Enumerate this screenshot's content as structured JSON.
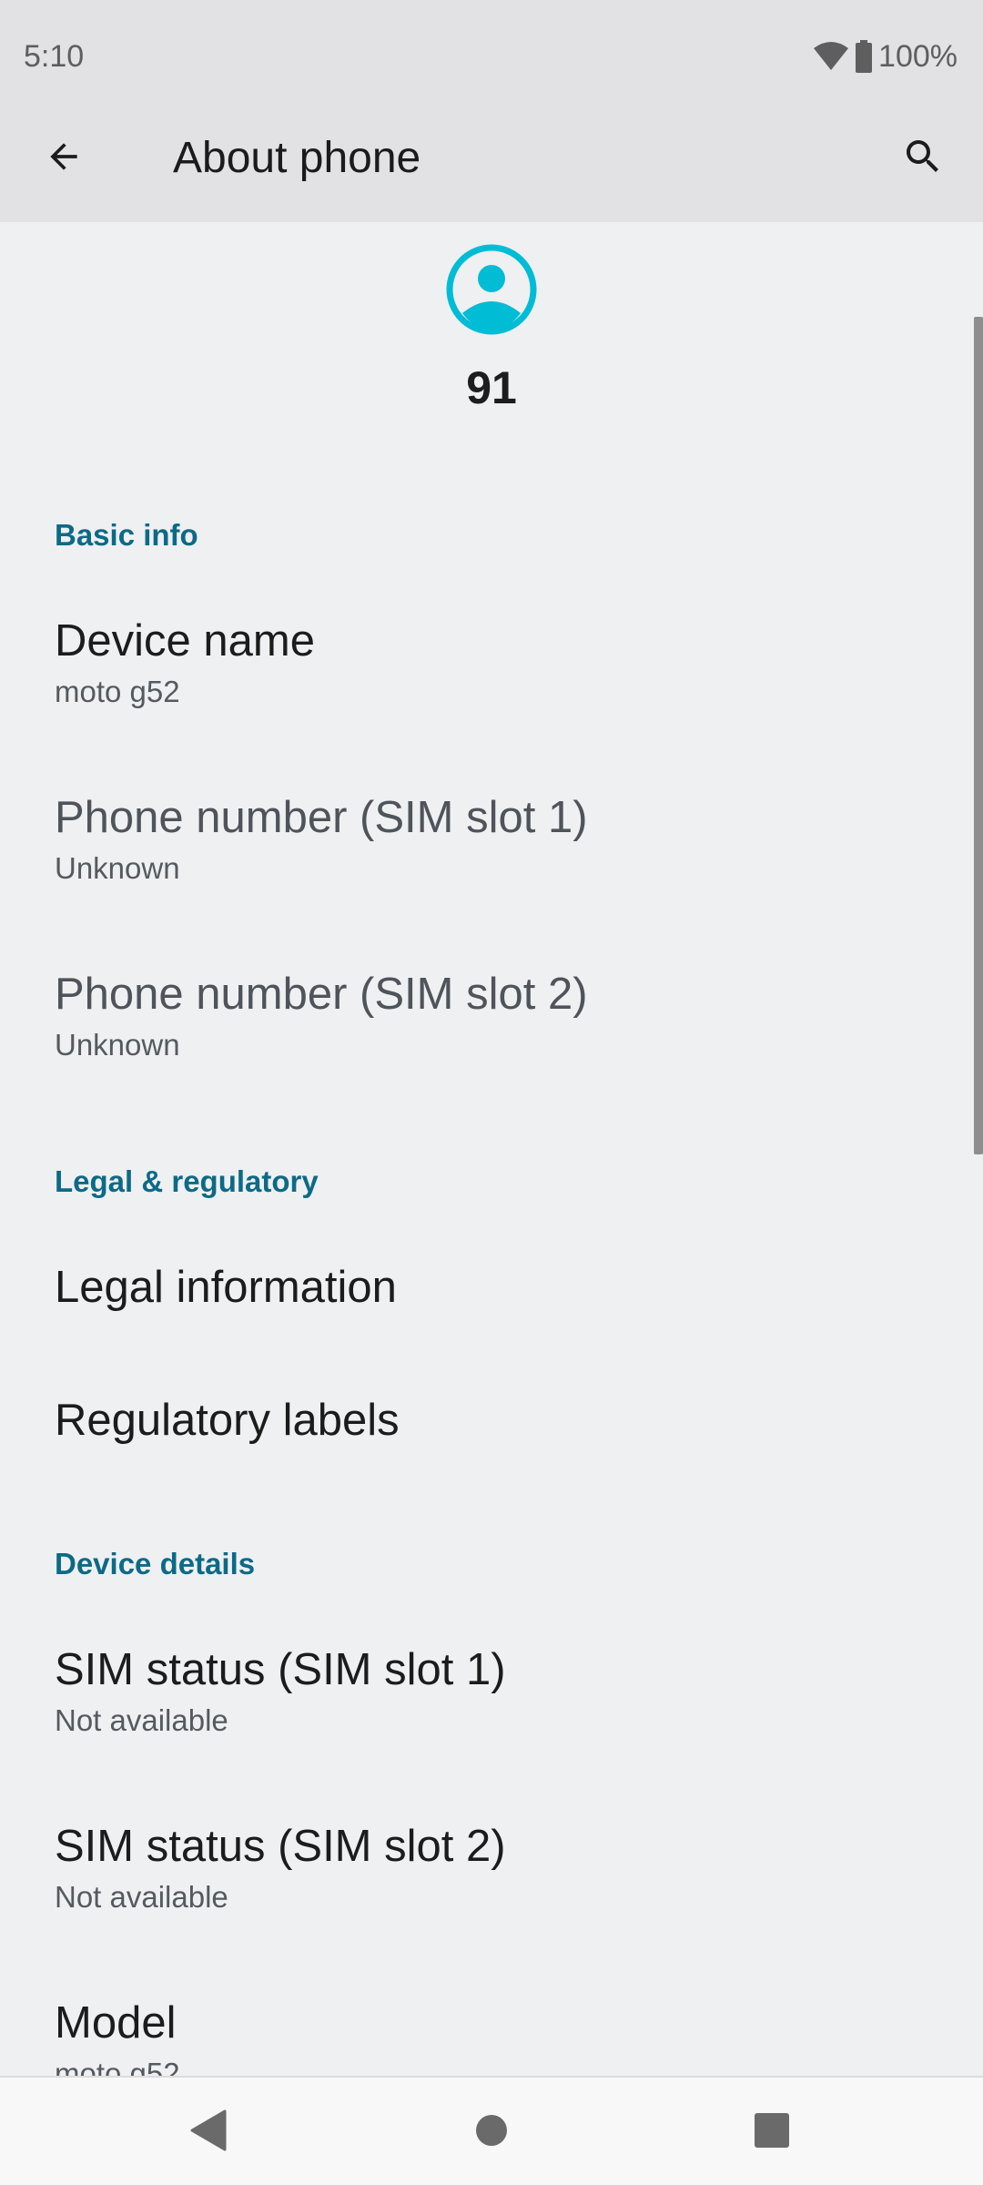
{
  "status_bar": {
    "time": "5:10",
    "battery_percent": "100%",
    "icons": [
      "wifi-icon",
      "battery-icon"
    ]
  },
  "app_bar": {
    "title": "About phone",
    "back_icon": "arrow-back-icon",
    "search_icon": "search-icon"
  },
  "profile": {
    "avatar_icon": "account-circle-icon",
    "avatar_color": "#00bcd4",
    "name": "91"
  },
  "sections": {
    "basic_info": "Basic info",
    "legal": "Legal & regulatory",
    "device_details": "Device details"
  },
  "prefs": {
    "device_name": {
      "title": "Device name",
      "summary": "moto g52"
    },
    "phone_sim1": {
      "title": "Phone number (SIM slot 1)",
      "summary": "Unknown"
    },
    "phone_sim2": {
      "title": "Phone number (SIM slot 2)",
      "summary": "Unknown"
    },
    "legal_info": {
      "title": "Legal information"
    },
    "regulatory_labels": {
      "title": "Regulatory labels"
    },
    "sim_status_1": {
      "title": "SIM status (SIM slot 1)",
      "summary": "Not available"
    },
    "sim_status_2": {
      "title": "SIM status (SIM slot 2)",
      "summary": "Not available"
    },
    "model": {
      "title": "Model",
      "summary": "moto g52"
    }
  },
  "nav_bar": {
    "icons": [
      "back-triangle-icon",
      "home-circle-icon",
      "recents-square-icon"
    ]
  },
  "colors": {
    "accent": "#0d6a86",
    "app_bar_bg": "#e2e2e4",
    "content_bg": "#eff0f2"
  }
}
